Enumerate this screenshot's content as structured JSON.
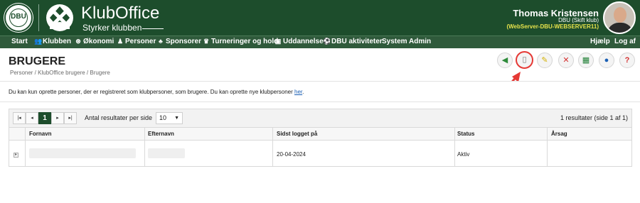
{
  "header": {
    "seal_text": "DBU",
    "brand_title": "KlubOffice",
    "brand_subtitle": "Styrker klubben",
    "user_name": "Thomas Kristensen",
    "user_club": "DBU (Skift klub)",
    "user_server": "(WebServer-DBU-WEBSERVER11)"
  },
  "nav": {
    "items": [
      {
        "label": "Start",
        "icon": ""
      },
      {
        "label": "Klubben",
        "icon": "people-icon"
      },
      {
        "label": "Økonomi",
        "icon": "coins-icon"
      },
      {
        "label": "Personer",
        "icon": "person-icon"
      },
      {
        "label": "Sponsorer",
        "icon": "sponsor-icon"
      },
      {
        "label": "Turneringer og hold",
        "icon": "trophy-icon"
      },
      {
        "label": "Uddannelse",
        "icon": "monitor-icon"
      },
      {
        "label": "DBU aktiviteter",
        "icon": "ball-icon"
      },
      {
        "label": "System Admin",
        "icon": ""
      }
    ],
    "help": "Hjælp",
    "logout": "Log af"
  },
  "page": {
    "title": "BRUGERE",
    "breadcrumb": "Personer / KlubOffice brugere / Brugere"
  },
  "toolbar": {
    "buttons": [
      "back-icon",
      "new-document-icon",
      "edit-icon",
      "delete-icon",
      "excel-icon",
      "help-circle-icon",
      "question-icon"
    ],
    "colors": {
      "highlight": "#e53935",
      "brand": "#1d4d2c"
    }
  },
  "info": {
    "text": "Du kan kun oprette personer, der er registreret som klubpersoner, som brugere. Du kan oprette nye klubpersoner ",
    "link": "her",
    "tail": "."
  },
  "grid": {
    "pager": {
      "current_page": "1",
      "per_page_label": "Antal resultater per side",
      "per_page_value": "10",
      "results": "1 resultater (side 1 af 1)",
      "first": "|◂",
      "prev": "◂",
      "next": "▸",
      "last": "▸|"
    },
    "columns": [
      "Fornavn",
      "Efternavn",
      "Sidst logget på",
      "Status",
      "Årsag"
    ],
    "rows": [
      {
        "fornavn": "",
        "efternavn": "",
        "sidst_logget_paa": "20-04-2024",
        "status": "Aktiv",
        "aarsag": ""
      }
    ]
  }
}
